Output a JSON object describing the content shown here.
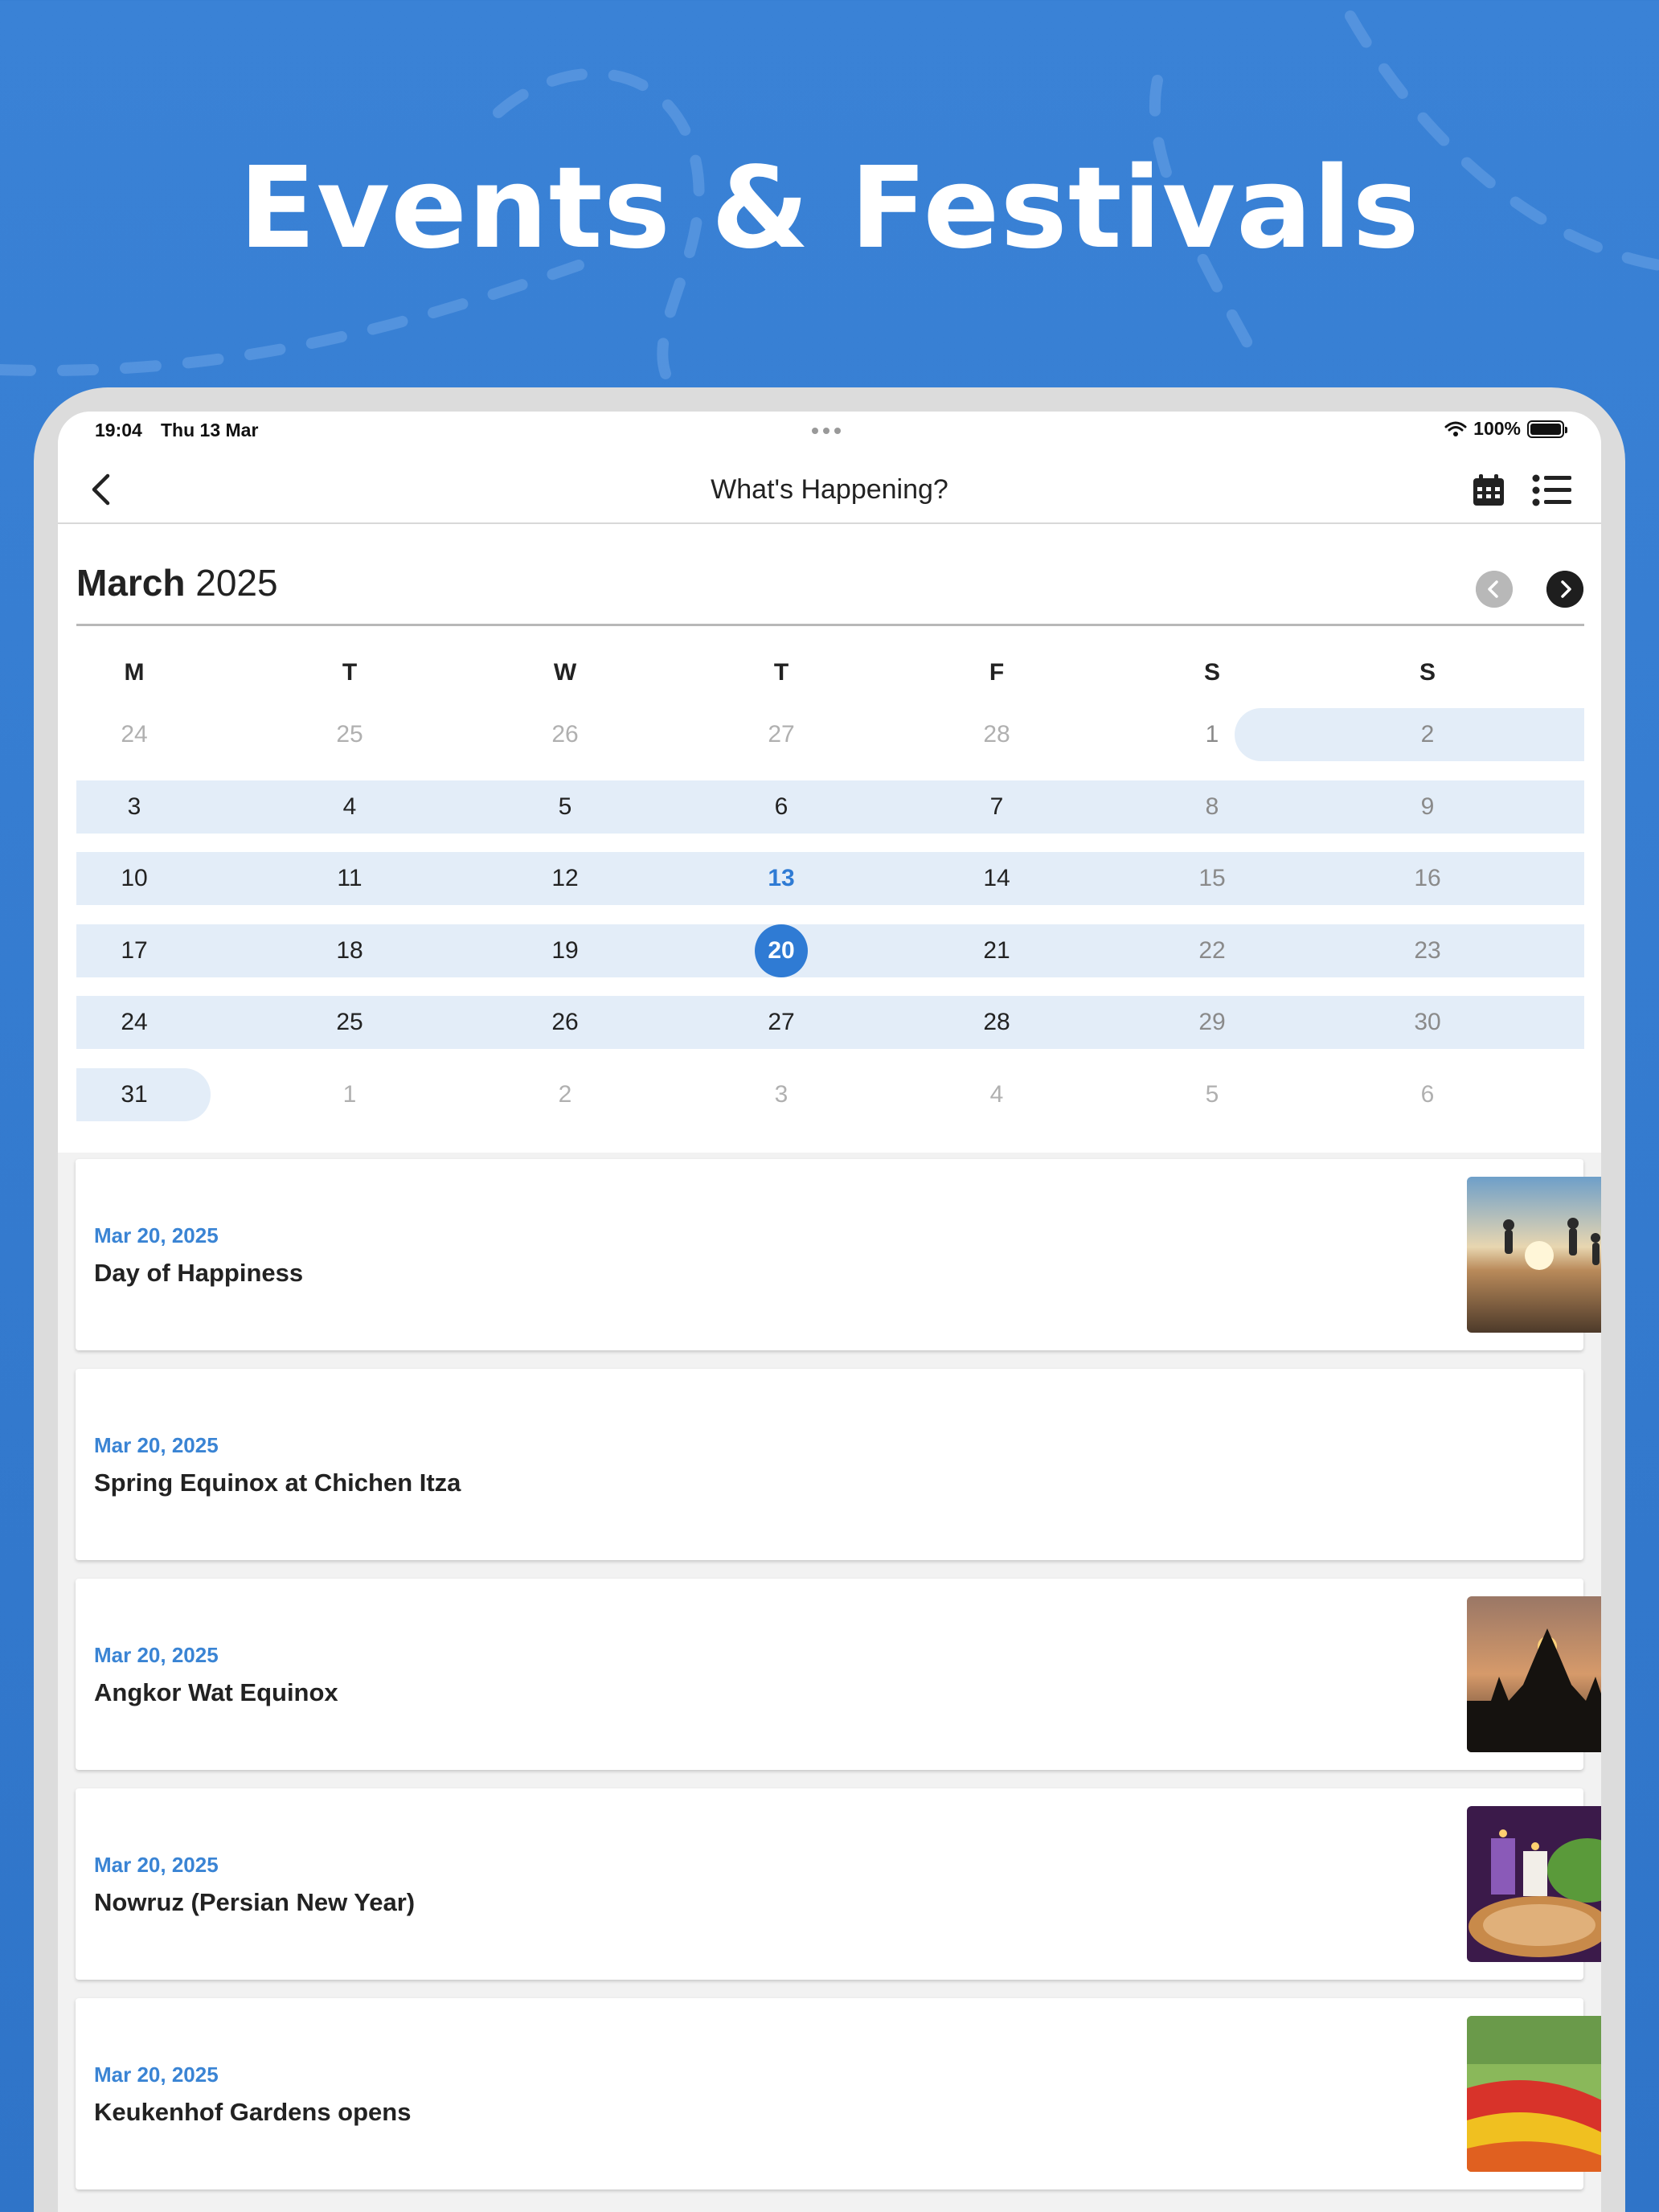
{
  "promo": {
    "title": "Events & Festivals"
  },
  "status": {
    "time": "19:04",
    "date": "Thu 13 Mar",
    "battery": "100%"
  },
  "nav": {
    "title": "What's Happening?"
  },
  "calendar": {
    "month": "March",
    "year": "2025",
    "weekdays": [
      "M",
      "T",
      "W",
      "T",
      "F",
      "S",
      "S"
    ],
    "weeks": [
      [
        "24",
        "25",
        "26",
        "27",
        "28",
        "1",
        "2"
      ],
      [
        "3",
        "4",
        "5",
        "6",
        "7",
        "8",
        "9"
      ],
      [
        "10",
        "11",
        "12",
        "13",
        "14",
        "15",
        "16"
      ],
      [
        "17",
        "18",
        "19",
        "20",
        "21",
        "22",
        "23"
      ],
      [
        "24",
        "25",
        "26",
        "27",
        "28",
        "29",
        "30"
      ],
      [
        "31",
        "1",
        "2",
        "3",
        "4",
        "5",
        "6"
      ]
    ],
    "today": "13",
    "selected": "20"
  },
  "events": [
    {
      "date": "Mar 20, 2025",
      "name": "Day of Happiness",
      "image": "people-jumping-beach-sunset"
    },
    {
      "date": "Mar 20, 2025",
      "name": "Spring Equinox at Chichen Itza",
      "image": ""
    },
    {
      "date": "Mar 20, 2025",
      "name": "Angkor Wat Equinox",
      "image": "angkor-wat-sunrise-silhouette"
    },
    {
      "date": "Mar 20, 2025",
      "name": "Nowruz (Persian New Year)",
      "image": "nowruz-candles-pastries"
    },
    {
      "date": "Mar 20, 2025",
      "name": "Keukenhof Gardens opens",
      "image": "tulip-garden"
    }
  ],
  "colors": {
    "accent": "#2f7bd4",
    "band": "#e3edf8",
    "background": "#3a82d6"
  }
}
